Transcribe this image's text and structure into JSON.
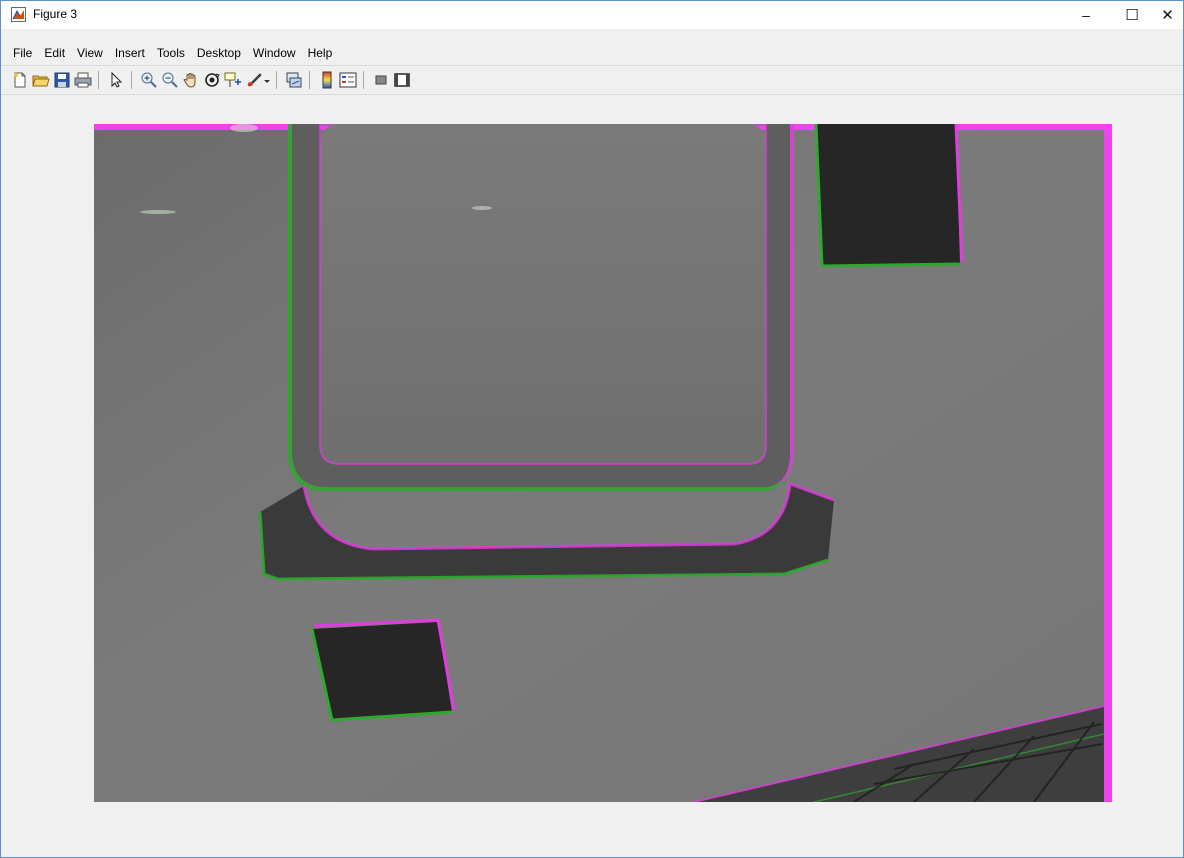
{
  "window": {
    "title": "Figure 3",
    "minimize_glyph": "–",
    "maximize_glyph": "☐",
    "close_glyph": "✕"
  },
  "menu": {
    "items": [
      "File",
      "Edit",
      "View",
      "Insert",
      "Tools",
      "Desktop",
      "Window",
      "Help"
    ]
  },
  "toolbar": {
    "buttons": [
      "new-figure-icon",
      "open-file-icon",
      "save-icon",
      "print-icon",
      "edit-plot-arrow-icon",
      "zoom-in-icon",
      "zoom-out-icon",
      "pan-hand-icon",
      "rotate-3d-icon",
      "data-cursor-icon",
      "brush-icon",
      "brush-dropdown-icon",
      "link-plot-icon",
      "insert-colorbar-icon",
      "insert-legend-icon",
      "hide-plot-tools-icon",
      "show-plot-tools-icon"
    ]
  },
  "colors": {
    "overlay_magenta": "#ff2cff",
    "overlay_green": "#2ea82e",
    "image_gray": "#7a7a7a",
    "background": "#f0f0f0"
  },
  "figure": {
    "content": "image-overlay"
  }
}
